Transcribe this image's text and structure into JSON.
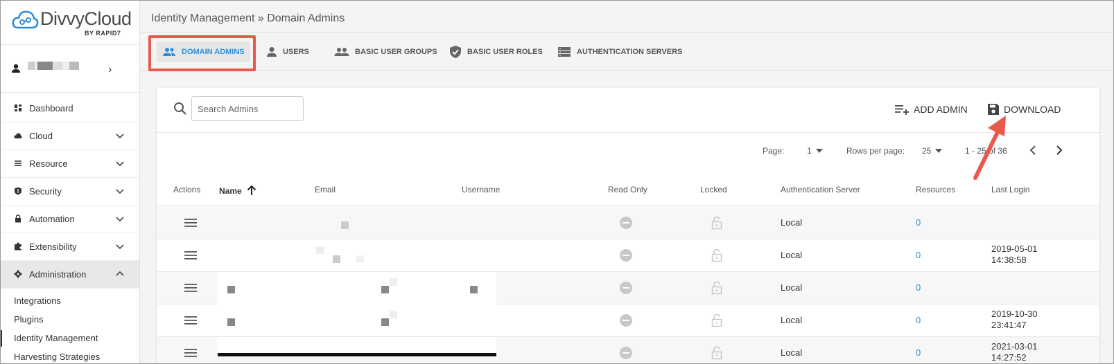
{
  "app": {
    "logo_text": "DivvyCloud",
    "logo_sub_by": "BY",
    "logo_sub_brand": "RAPID7"
  },
  "sidebar": {
    "items": [
      {
        "label": "Dashboard",
        "icon": "dashboard-icon"
      },
      {
        "label": "Cloud",
        "icon": "cloud-icon"
      },
      {
        "label": "Resource",
        "icon": "list-icon"
      },
      {
        "label": "Security",
        "icon": "shield-icon"
      },
      {
        "label": "Automation",
        "icon": "lock-icon"
      },
      {
        "label": "Extensibility",
        "icon": "puzzle-icon"
      },
      {
        "label": "Administration",
        "icon": "gear-icon"
      }
    ],
    "sub_items": [
      {
        "label": "Integrations"
      },
      {
        "label": "Plugins"
      },
      {
        "label": "Identity Management"
      },
      {
        "label": "Harvesting Strategies"
      }
    ]
  },
  "header": {
    "breadcrumb": "Identity Management » Domain Admins"
  },
  "tabs": [
    {
      "label": "DOMAIN ADMINS",
      "icon": "people-icon"
    },
    {
      "label": "USERS",
      "icon": "person-icon"
    },
    {
      "label": "BASIC USER GROUPS",
      "icon": "group-icon"
    },
    {
      "label": "BASIC USER ROLES",
      "icon": "shield-check-icon"
    },
    {
      "label": "AUTHENTICATION SERVERS",
      "icon": "server-icon"
    }
  ],
  "toolbar": {
    "search_placeholder": "Search Admins",
    "add_label": "ADD ADMIN",
    "download_label": "DOWNLOAD"
  },
  "pagination": {
    "page_label": "Page:",
    "page_value": "1",
    "rows_label": "Rows per page:",
    "rows_value": "25",
    "range_text": "1 - 25 of 36"
  },
  "table": {
    "columns": [
      "Actions",
      "Name",
      "Email",
      "Username",
      "Read Only",
      "Locked",
      "Authentication Server",
      "Resources",
      "Last Login"
    ],
    "rows": [
      {
        "auth": "Local",
        "resources": "0",
        "last_login_date": "",
        "last_login_time": ""
      },
      {
        "auth": "Local",
        "resources": "0",
        "last_login_date": "2019-05-01",
        "last_login_time": "14:38:58"
      },
      {
        "auth": "Local",
        "resources": "0",
        "last_login_date": "",
        "last_login_time": ""
      },
      {
        "auth": "Local",
        "resources": "0",
        "last_login_date": "2019-10-30",
        "last_login_time": "23:41:47"
      },
      {
        "auth": "Local",
        "resources": "0",
        "last_login_date": "2021-03-01",
        "last_login_time": "14:27:52"
      }
    ]
  },
  "colors": {
    "accent": "#2d8ed8",
    "highlight": "#e9584a"
  }
}
